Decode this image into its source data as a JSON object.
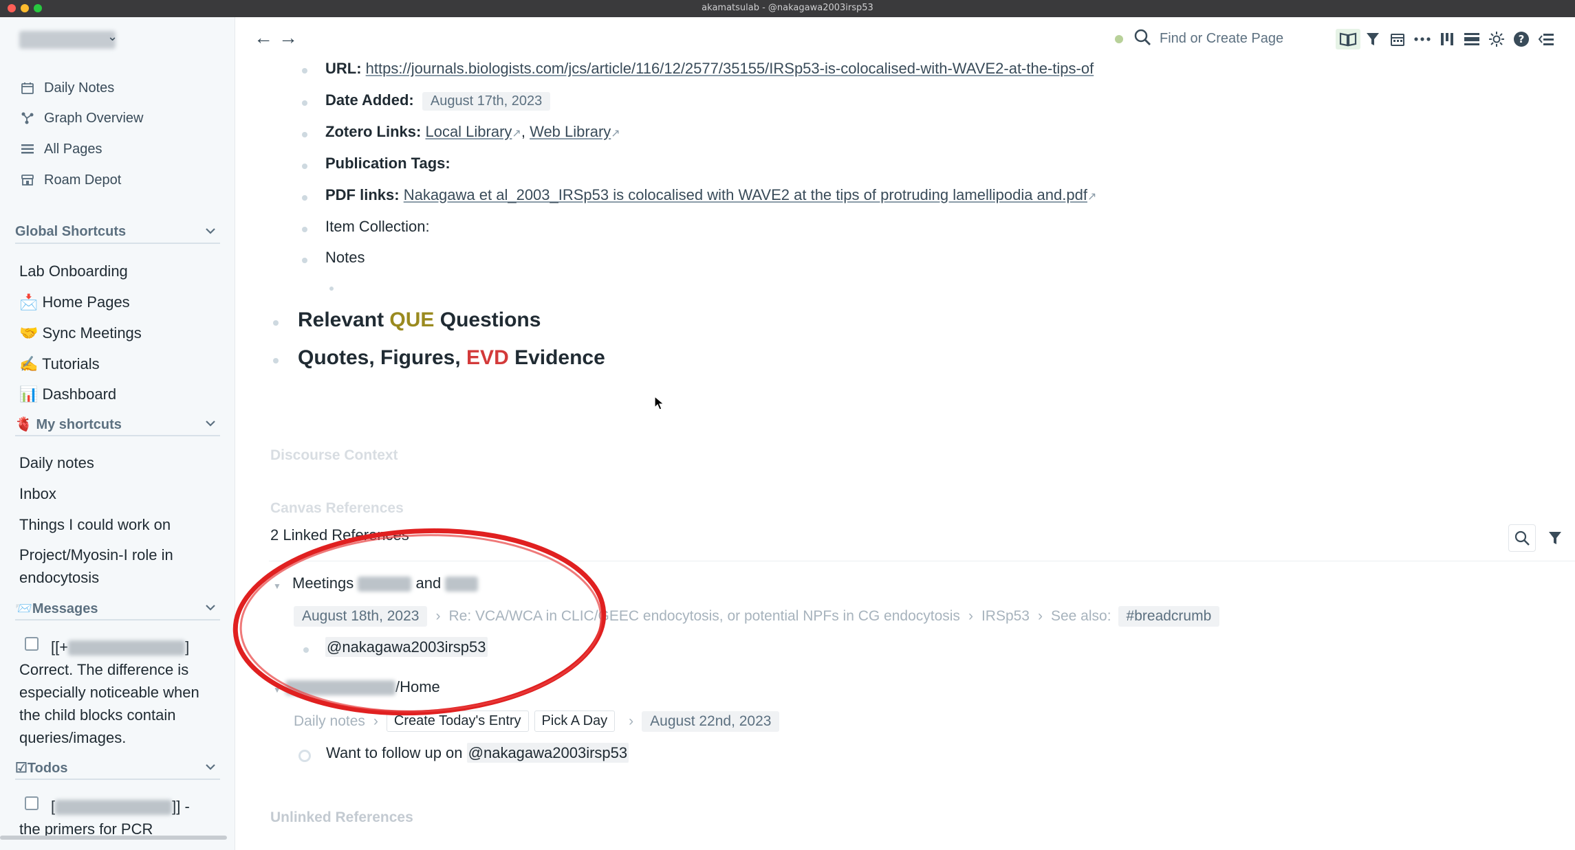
{
  "window": {
    "title": "akamatsulab - @nakagawa2003irsp53"
  },
  "sidebar": {
    "nav": [
      {
        "label": "Daily Notes",
        "icon": "calendar-icon"
      },
      {
        "label": "Graph Overview",
        "icon": "graph-icon"
      },
      {
        "label": "All Pages",
        "icon": "list-icon"
      },
      {
        "label": "Roam Depot",
        "icon": "store-icon"
      }
    ],
    "global_shortcuts": {
      "title": "Global Shortcuts",
      "items": [
        {
          "label": "Lab Onboarding"
        },
        {
          "label": "📩 Home Pages"
        },
        {
          "label": "🤝 Sync Meetings"
        },
        {
          "label": "✍️ Tutorials"
        },
        {
          "label": "📊 Dashboard"
        }
      ]
    },
    "my_shortcuts": {
      "title": "🫀 My shortcuts",
      "items": [
        {
          "label": "Daily notes"
        },
        {
          "label": "Inbox"
        },
        {
          "label": "Things I could work on"
        },
        {
          "label": "Project/Myosin-I role in endocytosis"
        }
      ]
    },
    "messages": {
      "title": "📨Messages",
      "prefix": "[[+",
      "suffix": "]",
      "text": "Correct. The difference is especially noticeable when the child blocks contain queries/images."
    },
    "todos": {
      "title": "☑Todos",
      "prefix": "[",
      "suffix": "]] -",
      "text": "the primers for PCR"
    }
  },
  "topbar": {
    "back": "←",
    "forward": "→",
    "search_placeholder": "Find or Create Page"
  },
  "page": {
    "url_label": "URL:",
    "url": "https://journals.biologists.com/jcs/article/116/12/2577/35155/IRSp53-is-colocalised-with-WAVE2-at-the-tips-of",
    "date_added_label": "Date Added:",
    "date_added": "August 17th, 2023",
    "zotero_label": "Zotero Links:",
    "zotero_local": "Local Library",
    "zotero_sep": ",",
    "zotero_web": "Web Library",
    "pub_tags_label": "Publication Tags:",
    "pdf_label": "PDF links:",
    "pdf_link": "Nakagawa et al_2003_IRSp53 is colocalised with WAVE2 at the tips of protruding lamellipodia and.pdf",
    "item_collection": "Item Collection:",
    "notes": "Notes",
    "h_relevant_pre": "Relevant ",
    "h_relevant_tag": "QUE",
    "h_relevant_post": " Questions",
    "h_quotes_pre": "Quotes, Figures, ",
    "h_quotes_tag": "EVD",
    "h_quotes_post": " Evidence",
    "discourse_context": "Discourse Context",
    "canvas_references": "Canvas References",
    "linked_refs": "2 Linked References",
    "ref1": {
      "title_pre": "Meetings",
      "title_mid": "and",
      "crumbs": [
        "August 18th, 2023",
        "Re: VCA/WCA in CLIC/GEEC endocytosis, or potential NPFs in CG endocytosis",
        "IRSp53",
        "See also:"
      ],
      "crumb_tag": "#breadcrumb",
      "block": "@nakagawa2003irsp53"
    },
    "ref2": {
      "title_suffix": "/Home",
      "crumb_first": "Daily notes",
      "chip1": "Create Today's Entry",
      "chip2": "Pick A Day",
      "crumb_date": "August 22nd, 2023",
      "block_pre": "Want to follow up on ",
      "block_tag": "@nakagawa2003irsp53"
    },
    "unlinked_refs": "Unlinked References"
  }
}
